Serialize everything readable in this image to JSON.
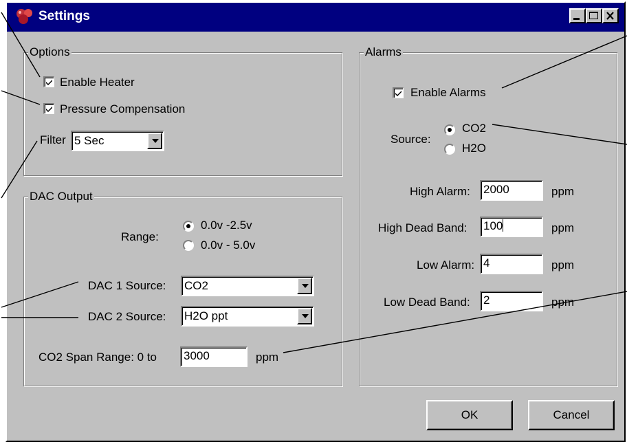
{
  "window": {
    "title": "Settings",
    "title_icon": "app-icon",
    "controls": [
      "minimize-icon",
      "maximize-icon",
      "close-icon"
    ]
  },
  "options": {
    "group_label": "Options",
    "enable_heater": {
      "label": "Enable Heater",
      "checked": true
    },
    "pressure_compensation": {
      "label": "Pressure Compensation",
      "checked": true
    },
    "filter": {
      "label": "Filter",
      "value": "5 Sec"
    }
  },
  "dac_output": {
    "group_label": "DAC Output",
    "range": {
      "label": "Range:",
      "options": [
        {
          "label": "0.0v -2.5v",
          "selected": true
        },
        {
          "label": "0.0v - 5.0v",
          "selected": false
        }
      ]
    },
    "dac1_source": {
      "label": "DAC 1 Source:",
      "value": "CO2"
    },
    "dac2_source": {
      "label": "DAC 2 Source:",
      "value": "H2O ppt"
    },
    "co2_span": {
      "label": "CO2 Span Range:  0 to",
      "value": "3000",
      "unit": "ppm"
    }
  },
  "alarms": {
    "group_label": "Alarms",
    "enable_alarms": {
      "label": "Enable Alarms",
      "checked": true
    },
    "source": {
      "label": "Source:",
      "options": [
        {
          "label": "CO2",
          "selected": true
        },
        {
          "label": "H2O",
          "selected": false
        }
      ]
    },
    "high_alarm": {
      "label": "High Alarm:",
      "value": "2000",
      "unit": "ppm"
    },
    "high_dead_band": {
      "label": "High Dead Band:",
      "value": "100",
      "unit": "ppm"
    },
    "low_alarm": {
      "label": "Low Alarm:",
      "value": "4",
      "unit": "ppm"
    },
    "low_dead_band": {
      "label": "Low Dead Band:",
      "value": "2",
      "unit": "ppm"
    }
  },
  "buttons": {
    "ok": "OK",
    "cancel": "Cancel"
  },
  "colors": {
    "titlebar": "#000080",
    "face": "#c0c0c0",
    "callout_lines": "#000000"
  }
}
